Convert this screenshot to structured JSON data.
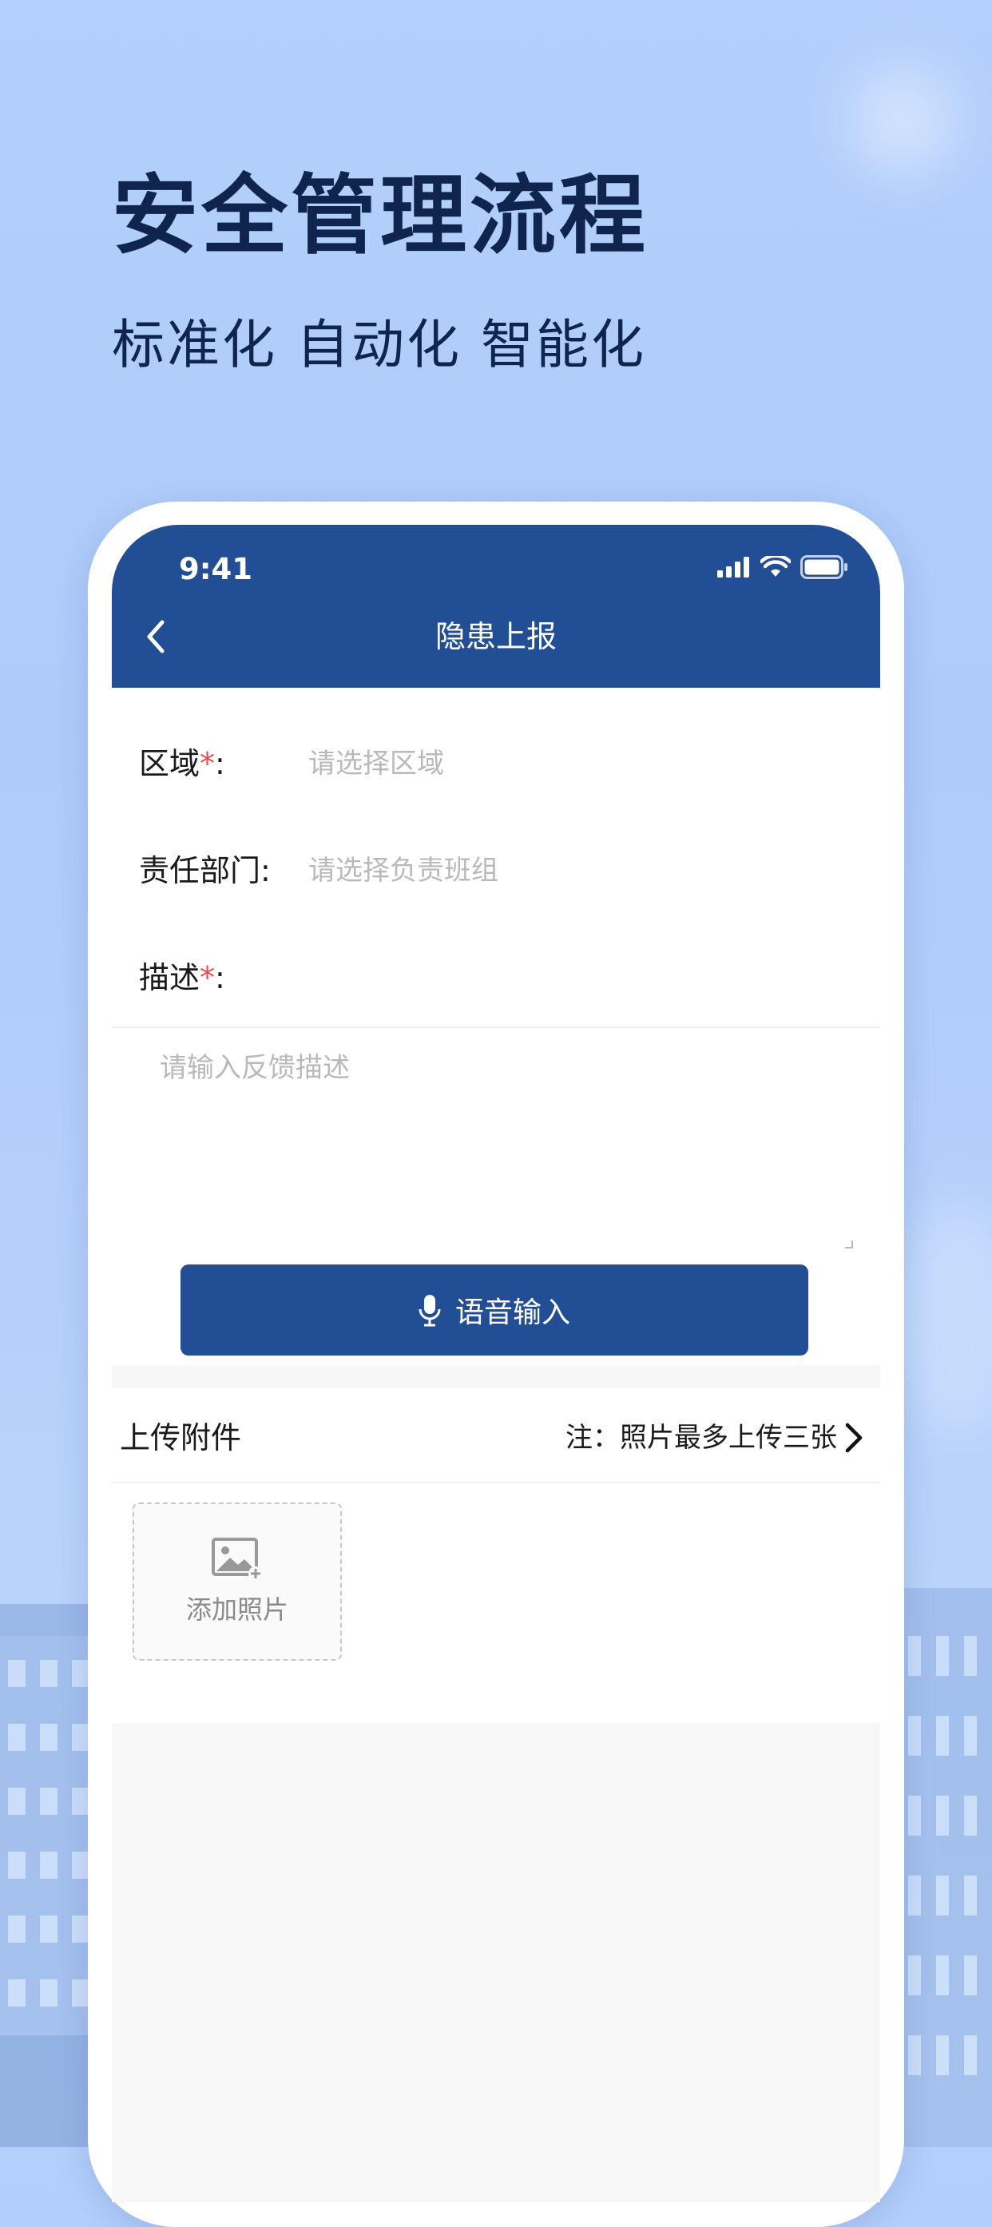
{
  "promo": {
    "title": "安全管理流程",
    "subtitle": "标准化 自动化 智能化"
  },
  "status_bar": {
    "time": "9:41",
    "icons": [
      "signal-icon",
      "wifi-icon",
      "battery-icon"
    ]
  },
  "nav": {
    "back_icon": "chevron-left-icon",
    "title": "隐患上报"
  },
  "form": {
    "area": {
      "label": "区域",
      "required_mark": "*",
      "colon": ":",
      "placeholder": "请选择区域"
    },
    "department": {
      "label": "责任部门:",
      "placeholder": "请选择负责班组"
    },
    "description": {
      "label": "描述",
      "required_mark": "*",
      "colon": ":",
      "placeholder": "请输入反馈描述"
    },
    "voice_button": {
      "icon": "microphone-icon",
      "label": "语音输入"
    }
  },
  "attachments": {
    "title": "上传附件",
    "note": "注：照片最多上传三张",
    "note_icon": "chevron-right-icon",
    "add_photo": {
      "icon": "add-image-icon",
      "label": "添加照片"
    }
  },
  "colors": {
    "primary": "#224e96",
    "required": "#e84a4a",
    "placeholder": "#b9b9b9",
    "promo_text": "#0f254d",
    "background": "#b3cffb"
  }
}
